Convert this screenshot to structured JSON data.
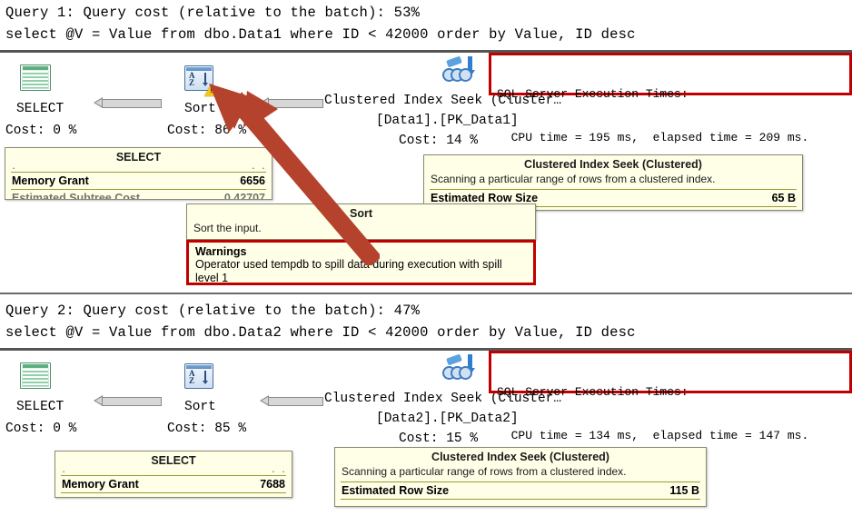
{
  "queries": [
    {
      "header": "Query 1: Query cost (relative to the batch): 53%",
      "sql": "select @V = Value from dbo.Data1 where ID < 42000 order by Value, ID desc",
      "operators": [
        {
          "icon": "select-result-icon",
          "label": "SELECT",
          "cost": "Cost: 0 %",
          "warning": false
        },
        {
          "icon": "sort-icon",
          "label": "Sort",
          "cost": "Cost: 86 %",
          "warning": true
        },
        {
          "icon": "clustered-index-seek-icon",
          "label": "Clustered Index Seek (Cluster…",
          "object": "[Data1].[PK_Data1]",
          "cost": "Cost: 14 %",
          "warning": false
        }
      ],
      "exec_times": {
        "line1": "SQL Server Execution Times:",
        "line2": "  CPU time = 195 ms,  elapsed time = 209 ms.",
        "cpu_ms": 195,
        "elapsed_ms": 209
      },
      "select_tooltip": {
        "title": "SELECT",
        "rows": [
          {
            "label": "Memory Grant",
            "value": "6656"
          },
          {
            "label": "Estimated Subtree Cost",
            "value": "0.42707"
          }
        ]
      },
      "sort_tooltip": {
        "title": "Sort",
        "desc": "Sort the input.",
        "warnings_title": "Warnings",
        "warnings_text": "Operator used tempdb to spill data during execution with spill level 1"
      },
      "seek_tooltip": {
        "title": "Clustered Index Seek (Clustered)",
        "desc": "Scanning a particular range of rows from a clustered index.",
        "rows": [
          {
            "label": "Estimated Row Size",
            "value": "65 B"
          }
        ]
      }
    },
    {
      "header": "Query 2: Query cost (relative to the batch): 47%",
      "sql": "select @V = Value from dbo.Data2 where ID < 42000 order by Value, ID desc",
      "operators": [
        {
          "icon": "select-result-icon",
          "label": "SELECT",
          "cost": "Cost: 0 %",
          "warning": false
        },
        {
          "icon": "sort-icon",
          "label": "Sort",
          "cost": "Cost: 85 %",
          "warning": false
        },
        {
          "icon": "clustered-index-seek-icon",
          "label": "Clustered Index Seek (Cluster…",
          "object": "[Data2].[PK_Data2]",
          "cost": "Cost: 15 %",
          "warning": false
        }
      ],
      "exec_times": {
        "line1": "SQL Server Execution Times:",
        "line2": "  CPU time = 134 ms,  elapsed time = 147 ms.",
        "cpu_ms": 134,
        "elapsed_ms": 147
      },
      "select_tooltip": {
        "title": "SELECT",
        "rows": [
          {
            "label": "Memory Grant",
            "value": "7688"
          }
        ]
      },
      "seek_tooltip": {
        "title": "Clustered Index Seek (Clustered)",
        "desc": "Scanning a particular range of rows from a clustered index.",
        "rows": [
          {
            "label": "Estimated Row Size",
            "value": "115 B"
          }
        ]
      }
    }
  ],
  "colors": {
    "highlight_border": "#c00000",
    "tooltip_bg": "#ffffe8",
    "tooltip_rule": "#9a9a33",
    "annotation_arrow": "#b5422c"
  }
}
